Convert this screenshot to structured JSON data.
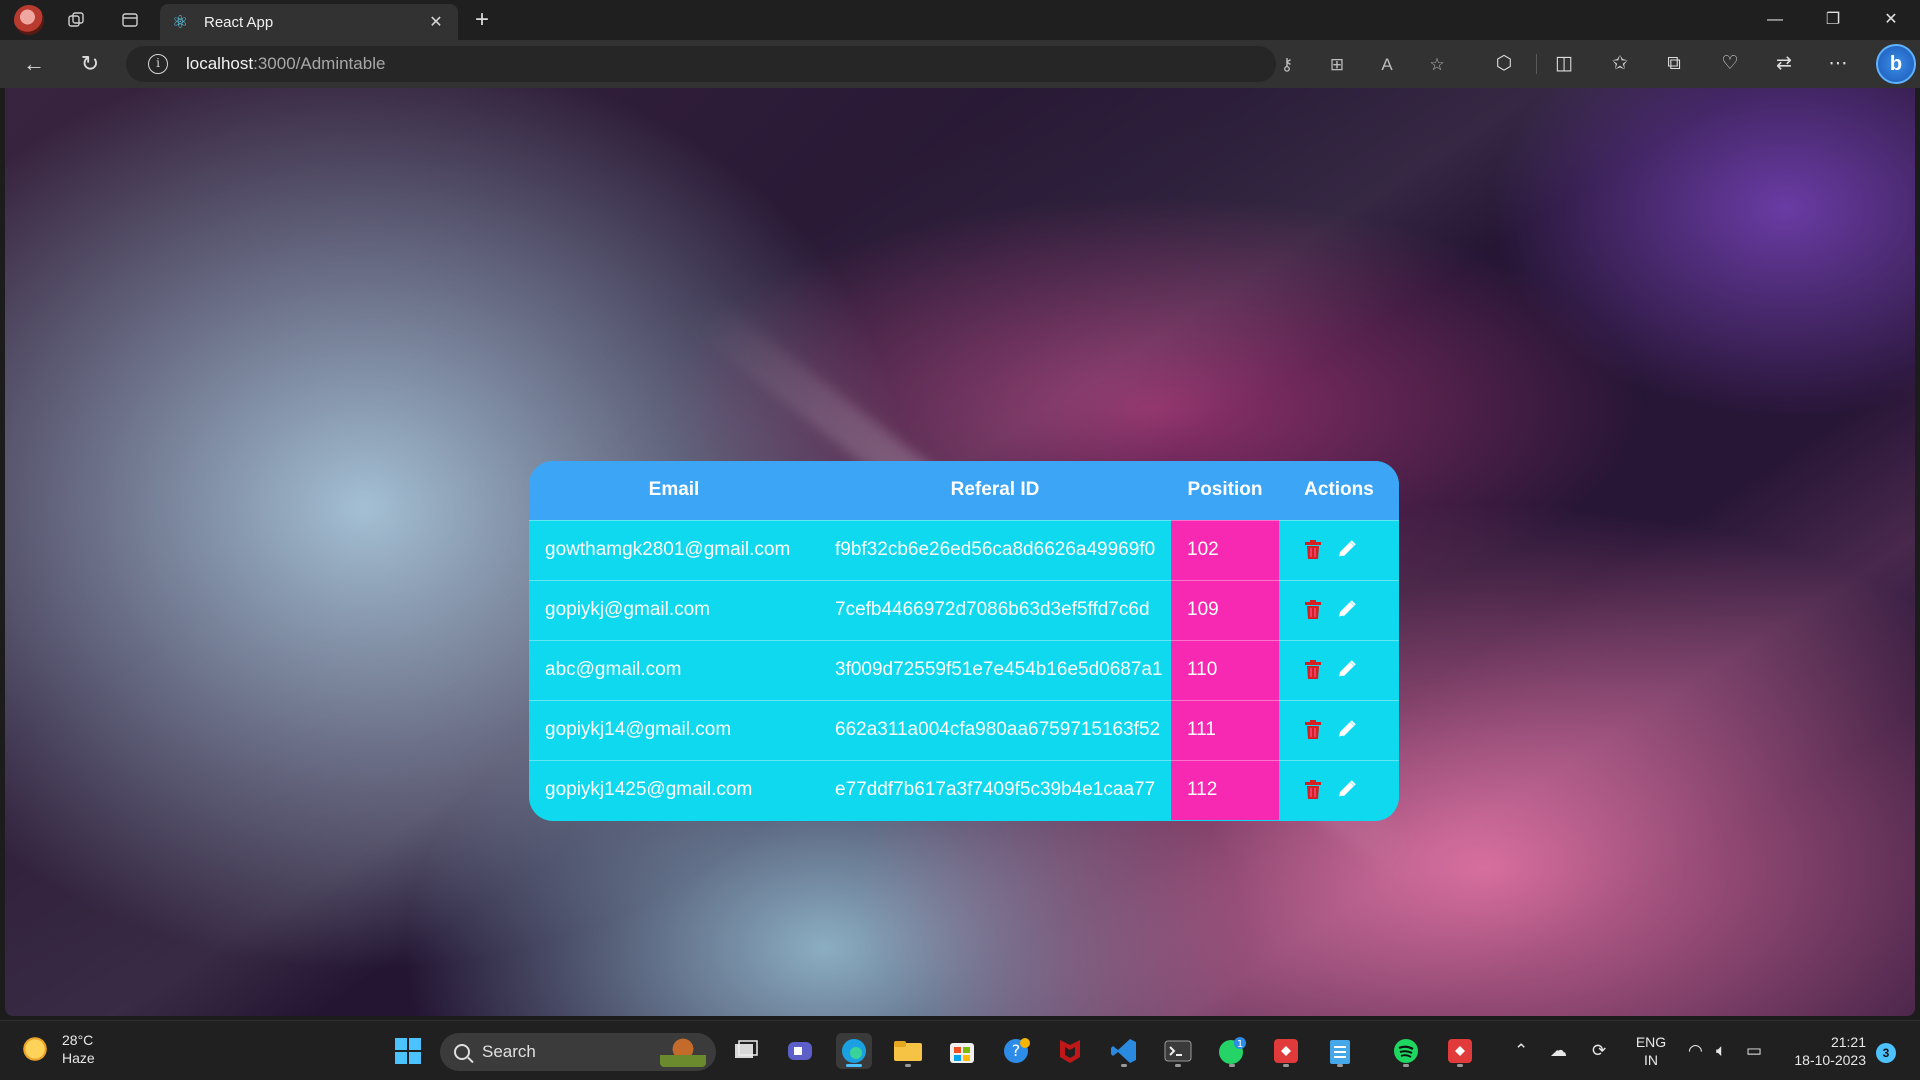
{
  "browser": {
    "tab_title": "React App",
    "url_host": "localhost",
    "url_rest": ":3000/Admintable"
  },
  "table": {
    "headers": [
      "Email",
      "Referal ID",
      "Position",
      "Actions"
    ],
    "rows": [
      {
        "email": "gowthamgk2801@gmail.com",
        "referal_id": "f9bf32cb6e26ed56ca8d6626a49969f0",
        "position": "102"
      },
      {
        "email": "gopiykj@gmail.com",
        "referal_id": "7cefb4466972d7086b63d3ef5ffd7c6d",
        "position": "109"
      },
      {
        "email": "abc@gmail.com",
        "referal_id": "3f009d72559f51e7e454b16e5d0687a1",
        "position": "110"
      },
      {
        "email": "gopiykj14@gmail.com",
        "referal_id": "662a311a004cfa980aa6759715163f52",
        "position": "111"
      },
      {
        "email": "gopiykj1425@gmail.com",
        "referal_id": "e77ddf7b617a3f7409f5c39b4e1caa77",
        "position": "112"
      }
    ],
    "colors": {
      "header": "#3da5f6",
      "body": "#0fd9ee",
      "position_cell": "#f728b2",
      "delete_icon": "#d42020"
    }
  },
  "taskbar": {
    "weather_temp": "28°C",
    "weather_desc": "Haze",
    "search_label": "Search",
    "lang_line1": "ENG",
    "lang_line2": "IN",
    "time": "21:21",
    "date": "18-10-2023",
    "notification_count": "3",
    "whatsapp_badge": "1"
  }
}
